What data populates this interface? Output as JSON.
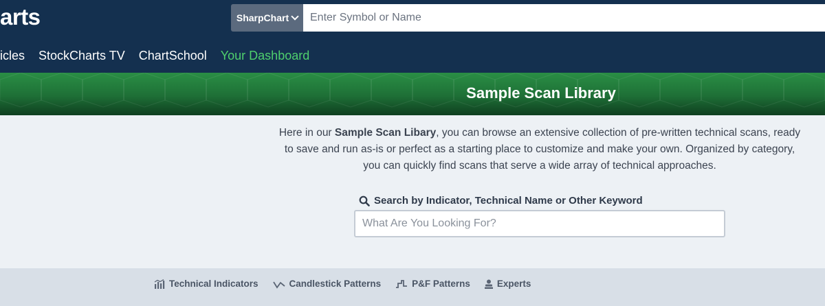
{
  "header": {
    "logo_text": "arts",
    "chart_type_label": "SharpChart",
    "symbol_placeholder": "Enter Symbol or Name"
  },
  "nav": {
    "items": [
      {
        "label": "ticles"
      },
      {
        "label": "StockCharts TV"
      },
      {
        "label": "ChartSchool"
      },
      {
        "label": "Your Dashboard"
      }
    ]
  },
  "banner": {
    "title": "Sample Scan Library"
  },
  "intro": {
    "prefix": "Here in our ",
    "bold": "Sample Scan Libary",
    "suffix": ", you can browse an extensive collection of pre-written technical scans, ready to save and run as-is or perfect as a starting place to customize and make your own. Organized by category, you can quickly find scans that serve a wide array of technical approaches."
  },
  "search": {
    "label": "Search by Indicator, Technical Name or Other Keyword",
    "placeholder": "What Are You Looking For?"
  },
  "categories": [
    {
      "label": "Technical Indicators",
      "icon": "bar-chart-icon"
    },
    {
      "label": "Candlestick Patterns",
      "icon": "line-chart-icon"
    },
    {
      "label": "P&F Patterns",
      "icon": "step-chart-icon"
    },
    {
      "label": "Experts",
      "icon": "expert-icon"
    }
  ],
  "colors": {
    "header_bg": "#14304f",
    "active_nav": "#4fd06d",
    "banner_green": "#1e6f36",
    "page_bg": "#edf1f5"
  }
}
